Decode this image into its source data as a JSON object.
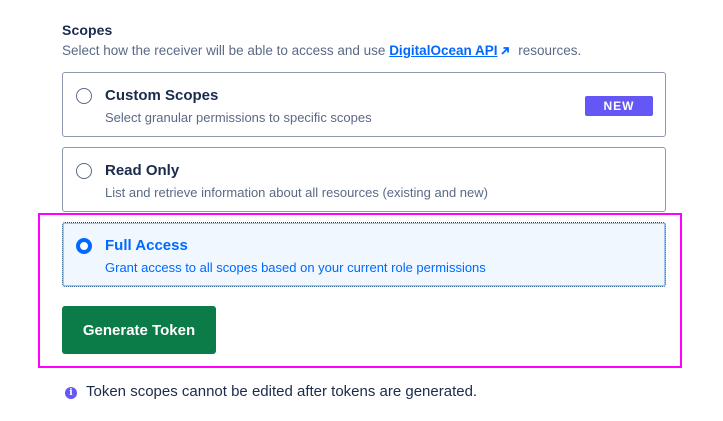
{
  "scopes": {
    "title": "Scopes",
    "description_before": "Select how the receiver will be able to access and use ",
    "link_text": "DigitalOcean API",
    "description_after": " resources.",
    "options": [
      {
        "title": "Custom Scopes",
        "description": "Select granular permissions to specific scopes",
        "badge": "NEW",
        "selected": false
      },
      {
        "title": "Read Only",
        "description": "List and retrieve information about all resources (existing and new)",
        "selected": false
      },
      {
        "title": "Full Access",
        "description": "Grant access to all scopes based on your current role permissions",
        "selected": true
      }
    ]
  },
  "actions": {
    "generate_label": "Generate Token"
  },
  "info": {
    "icon": "info-icon",
    "text": "Token scopes cannot be edited after tokens are generated."
  },
  "colors": {
    "primary_blue": "#0069ff",
    "badge_purple": "#6457f5",
    "button_green": "#0b7c47",
    "highlight_magenta": "#ff00ff"
  }
}
